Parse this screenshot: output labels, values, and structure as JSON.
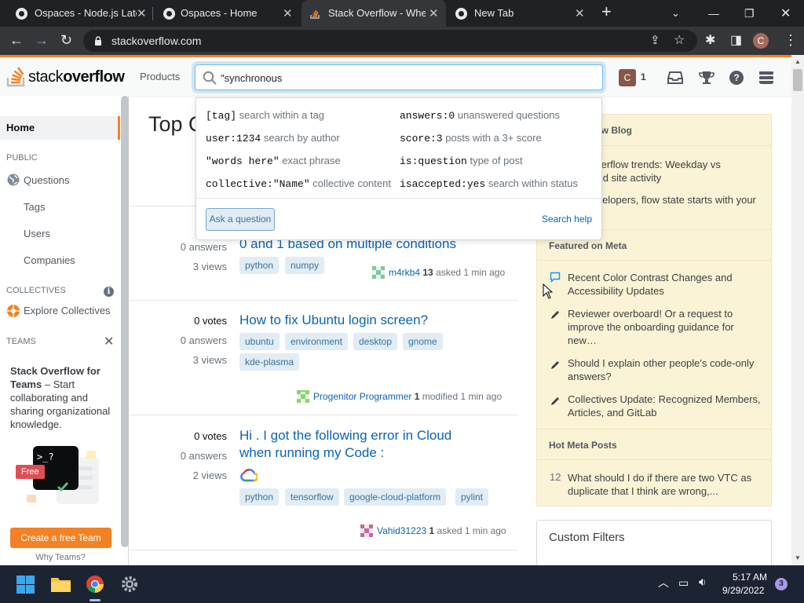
{
  "browser": {
    "tabs": [
      {
        "title": "Ospaces - Node.js Late"
      },
      {
        "title": "Ospaces - Home"
      },
      {
        "title": "Stack Overflow - Where"
      },
      {
        "title": "New Tab"
      }
    ],
    "url": "stackoverflow.com",
    "profile_initial": "C"
  },
  "header": {
    "logo_word1": "stack",
    "logo_word2": "overflow",
    "products": "Products",
    "search_value": "\"synchronous",
    "user_initial": "C",
    "reputation": "1"
  },
  "search_dropdown": {
    "tips": [
      {
        "code": "[tag]",
        "desc": "search within a tag"
      },
      {
        "code": "user:1234",
        "desc": "search by author"
      },
      {
        "code": "\"words here\"",
        "desc": "exact phrase"
      },
      {
        "code": "collective:\"Name\"",
        "desc": "collective content"
      },
      {
        "code": "answers:0",
        "desc": "unanswered questions"
      },
      {
        "code": "score:3",
        "desc": "posts with a 3+ score"
      },
      {
        "code": "is:question",
        "desc": "type of post"
      },
      {
        "code": "isaccepted:yes",
        "desc": "search within status"
      }
    ],
    "ask_button": "Ask a question",
    "help_link": "Search help"
  },
  "sidebar": {
    "home": "Home",
    "public_label": "PUBLIC",
    "questions": "Questions",
    "tags": "Tags",
    "users": "Users",
    "companies": "Companies",
    "collectives_label": "COLLECTIVES",
    "explore_collectives": "Explore Collectives",
    "teams_label": "TEAMS",
    "teams_title": "Stack Overflow for Teams",
    "teams_desc": " – Start collaborating and sharing organizational knowledge.",
    "free_badge": "Free",
    "create_team": "Create a free Team",
    "why_teams": "Why Teams?"
  },
  "main": {
    "title_visible": "Top Q",
    "questions": [
      {
        "votes": "",
        "answers": "0 answers",
        "views": "3 views",
        "title": "0 and 1 based on multiple conditions",
        "tags": [
          "python",
          "numpy"
        ],
        "user": "m4rkb4",
        "rep": "13",
        "action": "asked 1 min ago"
      },
      {
        "votes": "0 votes",
        "answers": "0 answers",
        "views": "3 views",
        "title": "How to fix Ubuntu login screen?",
        "tags": [
          "ubuntu",
          "environment",
          "desktop",
          "gnome",
          "kde-plasma"
        ],
        "user": "Progenitor Programmer",
        "rep": "1",
        "action": "modified 1 min ago"
      },
      {
        "votes": "0 votes",
        "answers": "0 answers",
        "views": "2 views",
        "title": "Hi . I got the following error in Cloud when running my Code :",
        "tags": [
          "python",
          "tensorflow",
          "google-cloud-platform",
          "pylint"
        ],
        "user": "Vahid31223",
        "rep": "1",
        "action": "asked 1 min ago"
      }
    ]
  },
  "right": {
    "blog_header": "The Overflow Blog",
    "blog_items": [
      "The Overflow trends: Weekday vs weekend site activity",
      "For developers, flow state starts with your laptops"
    ],
    "meta_header": "Featured on Meta",
    "meta_items": [
      "Recent Color Contrast Changes and Accessibility Updates",
      "Reviewer overboard! Or a request to improve the onboarding guidance for new…",
      "Should I explain other people's code-only answers?",
      "Collectives Update: Recognized Members, Articles, and GitLab"
    ],
    "hot_header": "Hot Meta Posts",
    "hot_items": [
      {
        "count": "12",
        "title": "What should I do if there are two VTC as duplicate that I think are wrong,..."
      }
    ],
    "custom_filters": "Custom Filters"
  },
  "taskbar": {
    "time": "5:17 AM",
    "date": "9/29/2022",
    "notifications": "3"
  },
  "colors": {
    "accent": "#f48225",
    "link": "#0a63b5",
    "tag_bg": "#e1ecf4"
  }
}
